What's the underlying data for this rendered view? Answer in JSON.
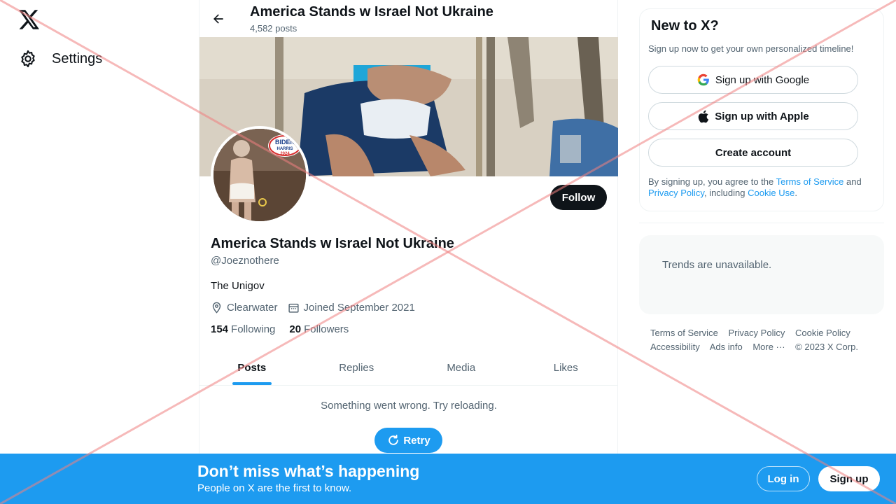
{
  "nav": {
    "logo_icon": "x-logo-icon",
    "settings_label": "Settings",
    "settings_icon": "gear-icon"
  },
  "header": {
    "back_icon": "arrow-left-icon",
    "title": "America Stands w Israel Not Ukraine",
    "posts_count": "4,582 posts"
  },
  "profile": {
    "follow_label": "Follow",
    "name": "America Stands w Israel Not Ukraine",
    "handle": "@Joeznothere",
    "bio": "The Unigov",
    "location": "Clearwater",
    "location_icon": "location-pin-icon",
    "joined": "Joined September 2021",
    "joined_icon": "calendar-icon",
    "following_count": "154",
    "following_label": "Following",
    "followers_count": "20",
    "followers_label": "Followers",
    "avatar_badge": {
      "line1": "BIDEN",
      "line2": "HARRIS",
      "line3": "2024"
    }
  },
  "tabs": [
    {
      "label": "Posts",
      "active": true
    },
    {
      "label": "Replies",
      "active": false
    },
    {
      "label": "Media",
      "active": false
    },
    {
      "label": "Likes",
      "active": false
    }
  ],
  "feed": {
    "error_message": "Something went wrong. Try reloading.",
    "retry_label": "Retry",
    "retry_icon": "refresh-icon"
  },
  "signup_card": {
    "title": "New to X?",
    "subtitle": "Sign up now to get your own personalized timeline!",
    "google_label": "Sign up with Google",
    "google_icon": "google-icon",
    "apple_label": "Sign up with Apple",
    "apple_icon": "apple-icon",
    "create_label": "Create account",
    "terms_prefix": "By signing up, you agree to the ",
    "terms_link": "Terms of Service",
    "terms_and": " and ",
    "privacy_link": "Privacy Policy",
    "terms_including": ", including ",
    "cookie_link": "Cookie Use",
    "terms_end": "."
  },
  "trends": {
    "message": "Trends are unavailable."
  },
  "footer": {
    "links": [
      "Terms of Service",
      "Privacy Policy",
      "Cookie Policy",
      "Accessibility",
      "Ads info",
      "More ···"
    ],
    "copyright": "© 2023 X Corp."
  },
  "bottom_bar": {
    "title": "Don’t miss what’s happening",
    "subtitle": "People on X are the first to know.",
    "login_label": "Log in",
    "signup_label": "Sign up"
  },
  "colors": {
    "accent": "#1d9bf0",
    "text_primary": "#0f1419",
    "text_secondary": "#536471",
    "overlay_cross": "#f08080"
  }
}
